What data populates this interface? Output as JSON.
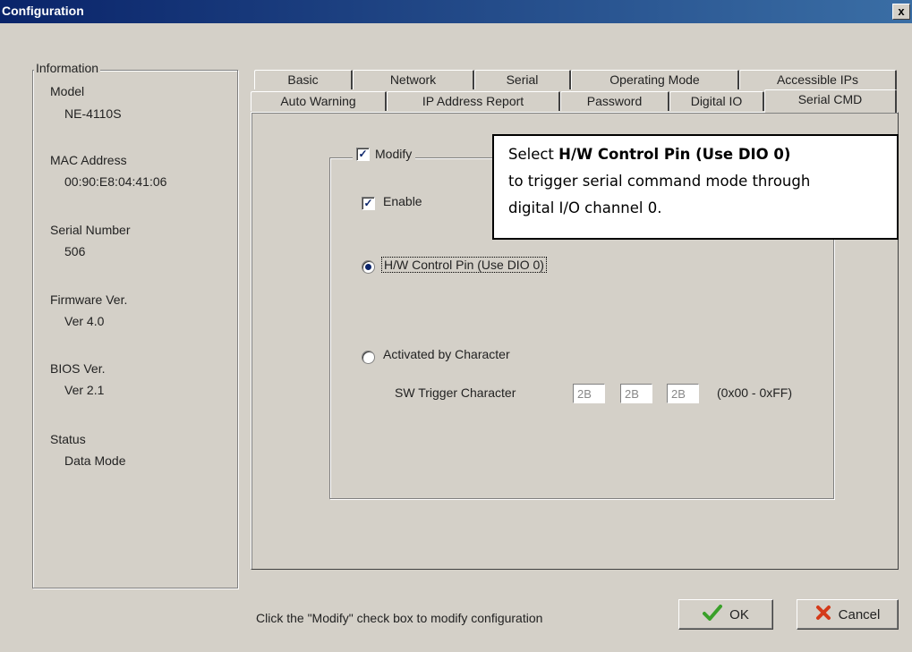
{
  "window": {
    "title": "Configuration",
    "close_glyph": "x"
  },
  "information": {
    "legend": "Information",
    "fields": [
      {
        "label": "Model",
        "value": "NE-4110S"
      },
      {
        "label": "MAC Address",
        "value": "00:90:E8:04:41:06"
      },
      {
        "label": "Serial Number",
        "value": "506"
      },
      {
        "label": "Firmware Ver.",
        "value": "Ver 4.0"
      },
      {
        "label": "BIOS Ver.",
        "value": "Ver 2.1"
      },
      {
        "label": "Status",
        "value": "Data Mode"
      }
    ]
  },
  "tabs": {
    "row1": [
      "Basic",
      "Network",
      "Serial",
      "Operating Mode",
      "Accessible IPs"
    ],
    "row2": [
      "Auto Warning",
      "IP Address Report",
      "Password",
      "Digital IO",
      "Serial CMD"
    ],
    "active": "Serial CMD"
  },
  "serial_cmd": {
    "modify_label": "Modify",
    "modify_checked": true,
    "enable_label": "Enable",
    "enable_checked": true,
    "option_hw_label": "H/W Control Pin (Use DIO 0)",
    "option_hw_selected": true,
    "option_char_label": "Activated by Character",
    "option_char_selected": false,
    "sw_trigger_label": "SW Trigger Character",
    "sw_trigger_values": [
      "2B",
      "2B",
      "2B"
    ],
    "range_hint": "(0x00 - 0xFF)"
  },
  "callout": {
    "prefix": "Select ",
    "bold": "H/W Control Pin (Use DIO 0)",
    "line2": "to trigger serial command mode through",
    "line3": "digital I/O channel 0."
  },
  "footer": {
    "hint": "Click the \"Modify\" check box to modify configuration",
    "ok_label": "OK",
    "cancel_label": "Cancel",
    "ok_icon": "checkmark-icon",
    "cancel_icon": "x-icon",
    "ok_icon_color": "#3aa02a",
    "cancel_icon_color": "#d43a1a"
  }
}
